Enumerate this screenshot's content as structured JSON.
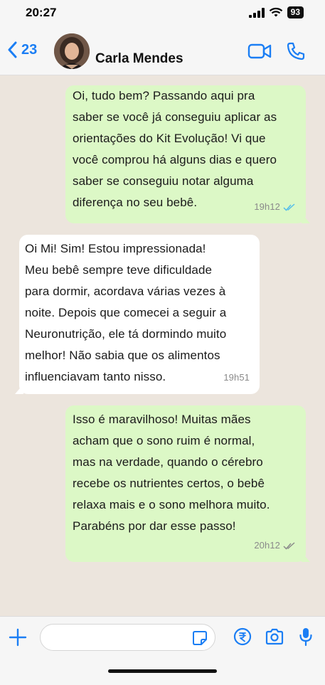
{
  "status_bar": {
    "time": "20:27",
    "battery": "93"
  },
  "header": {
    "back_count": "23",
    "contact_name": "Carla Mendes"
  },
  "messages": [
    {
      "direction": "outgoing",
      "text": " Oi, tudo bem? Passando aqui pra\nsaber se você já conseguiu aplicar as\norientações do Kit Evolução! Vi que\nvocê comprou há alguns dias e quero\nsaber se conseguiu notar alguma\ndiferença no seu bebê.",
      "time": "19h12",
      "status": "read"
    },
    {
      "direction": "incoming",
      "text": " Oi Mi! Sim! Estou impressionada!\nMeu bebê sempre teve dificuldade\npara dormir, acordava várias vezes à\nnoite. Depois que comecei a seguir a\nNeuronutrição, ele tá dormindo muito\nmelhor! Não sabia que os alimentos\ninfluenciavam tanto nisso.",
      "time": "19h51"
    },
    {
      "direction": "outgoing",
      "text": " Isso é maravilhoso! Muitas mães\nacham que o sono ruim é normal,\nmas na verdade, quando o cérebro\nrecebe os nutrientes certos, o bebê\nrelaxa mais e o sono melhora muito.\nParabéns por dar esse passo!",
      "time": "20h12",
      "status": "read"
    }
  ],
  "composer": {
    "input_value": ""
  },
  "colors": {
    "accent": "#1b7ef4",
    "outgoing_bubble": "#dcf8c6",
    "incoming_bubble": "#ffffff",
    "chat_background": "#ece5dd",
    "read_ticks": "#53bdeb"
  }
}
